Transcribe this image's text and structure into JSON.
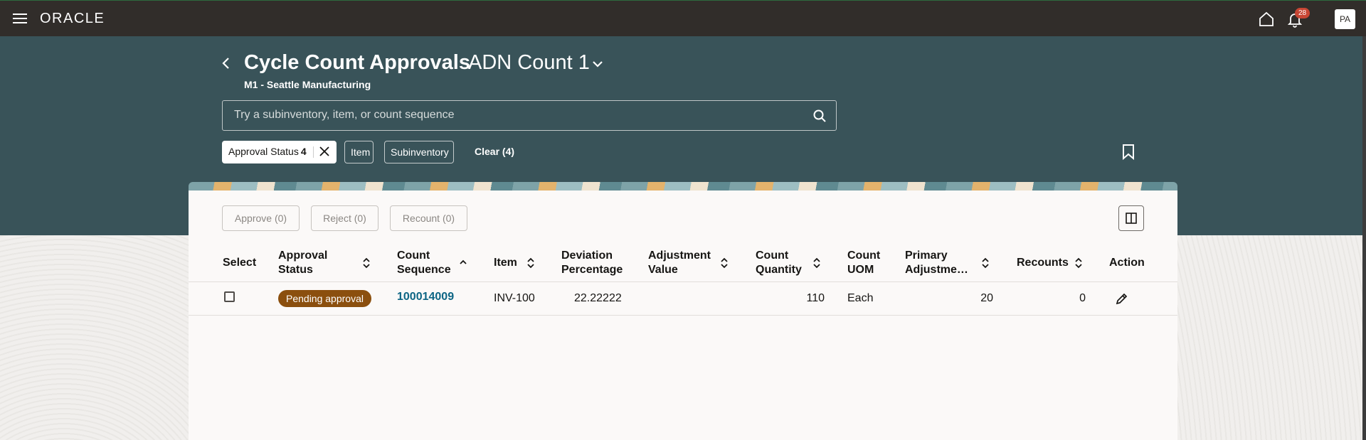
{
  "topbar": {
    "brand": "ORACLE",
    "notifications_count": "28",
    "avatar_initials": "PA"
  },
  "header": {
    "title": "Cycle Count Approvals",
    "count_name": "ADN Count 1",
    "organization": "M1 - Seattle Manufacturing"
  },
  "search": {
    "placeholder": "Try a subinventory, item, or count sequence"
  },
  "filters": {
    "approval_status_label": "Approval Status",
    "approval_status_count": "4",
    "item_label": "Item",
    "subinventory_label": "Subinventory",
    "clear_label": "Clear (4)"
  },
  "toolbar": {
    "approve_label": "Approve (0)",
    "reject_label": "Reject (0)",
    "recount_label": "Recount (0)"
  },
  "table": {
    "columns": {
      "select": "Select",
      "approval_status_1": "Approval",
      "approval_status_2": "Status",
      "count_sequence_1": "Count",
      "count_sequence_2": "Sequence",
      "item": "Item",
      "deviation_1": "Deviation",
      "deviation_2": "Percentage",
      "adjustment_1": "Adjustment",
      "adjustment_2": "Value",
      "count_qty_1": "Count",
      "count_qty_2": "Quantity",
      "count_uom_1": "Count",
      "count_uom_2": "UOM",
      "primary_adj_1": "Primary",
      "primary_adj_2": "Adjustme…",
      "recounts": "Recounts",
      "action": "Action"
    },
    "rows": [
      {
        "approval_status": "Pending approval",
        "count_sequence": "100014009",
        "item": "INV-100",
        "deviation_percentage": "22.22222",
        "adjustment_value": "",
        "count_quantity": "110",
        "count_uom": "Each",
        "primary_adjustment": "20",
        "recounts": "0"
      }
    ]
  },
  "colors": {
    "topbar": "#312d2a",
    "header_band": "#395359",
    "status_badge": "#8b4f0e",
    "link": "#0d6584",
    "notification_badge": "#c74634"
  }
}
